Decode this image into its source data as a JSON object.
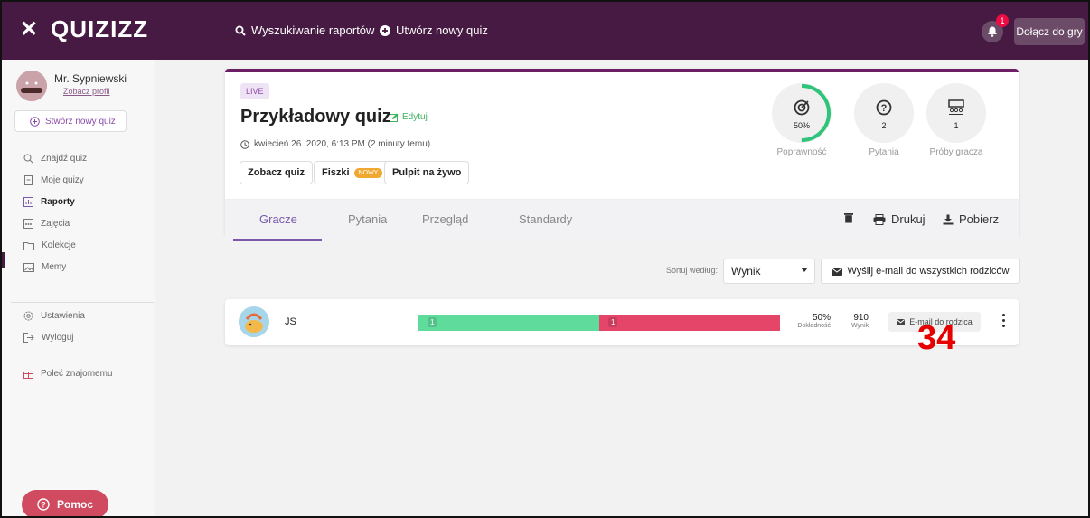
{
  "header": {
    "logo": "QUIZIZZ",
    "search_reports": "Wyszukiwanie raportów",
    "create_quiz": "Utwórz nowy quiz",
    "notification_count": "1",
    "join_game": "Dołącz do gry"
  },
  "sidebar": {
    "user_name": "Mr. Sypniewski",
    "profile_link": "Zobacz profil",
    "create_quiz": "Stwórz nowy quiz",
    "items": [
      {
        "label": "Znajdź quiz",
        "icon": "search-icon"
      },
      {
        "label": "Moje quizy",
        "icon": "document-icon"
      },
      {
        "label": "Raporty",
        "icon": "chart-icon"
      },
      {
        "label": "Zajęcia",
        "icon": "class-icon"
      },
      {
        "label": "Kolekcje",
        "icon": "folder-icon"
      },
      {
        "label": "Memy",
        "icon": "image-icon"
      },
      {
        "label": "Ustawienia",
        "icon": "gear-icon"
      },
      {
        "label": "Wyloguj",
        "icon": "logout-icon"
      },
      {
        "label": "Poleć znajomemu",
        "icon": "gift-icon"
      }
    ],
    "help": "Pomoc"
  },
  "report": {
    "live_badge": "LIVE",
    "title": "Przykładowy quiz",
    "edit": "Edytuj",
    "date": "kwiecień 26. 2020, 6:13 PM (2 minuty temu)",
    "buttons": {
      "view_quiz": "Zobacz quiz",
      "flashcards": "Fiszki",
      "new_badge": "NOWY",
      "live_dashboard": "Pulpit na żywo"
    },
    "stats": {
      "accuracy_value": "50%",
      "accuracy_fraction": 0.5,
      "accuracy_label": "Poprawność",
      "questions_value": "2",
      "questions_label": "Pytania",
      "attempts_value": "1",
      "attempts_label": "Próby gracza"
    },
    "tabs": [
      "Gracze",
      "Pytania",
      "Przegląd",
      "Standardy"
    ],
    "actions": {
      "print": "Drukuj",
      "download": "Pobierz"
    }
  },
  "sort": {
    "label": "Sortuj według:",
    "value": "Wynik",
    "email_all": "Wyślij e-mail do wszystkich rodziców"
  },
  "player": {
    "name": "JS",
    "correct": "1",
    "incorrect": "1",
    "correct_fraction": 0.5,
    "accuracy": "50%",
    "accuracy_label": "Dokładność",
    "score": "910",
    "score_label": "Wynik",
    "email_parent": "E-mail do rodzica"
  },
  "colors": {
    "topbar": "#461a42",
    "correct": "#5fdc9c",
    "incorrect": "#e6456a",
    "accent": "#7a5aa8"
  },
  "overlay_number": "34"
}
